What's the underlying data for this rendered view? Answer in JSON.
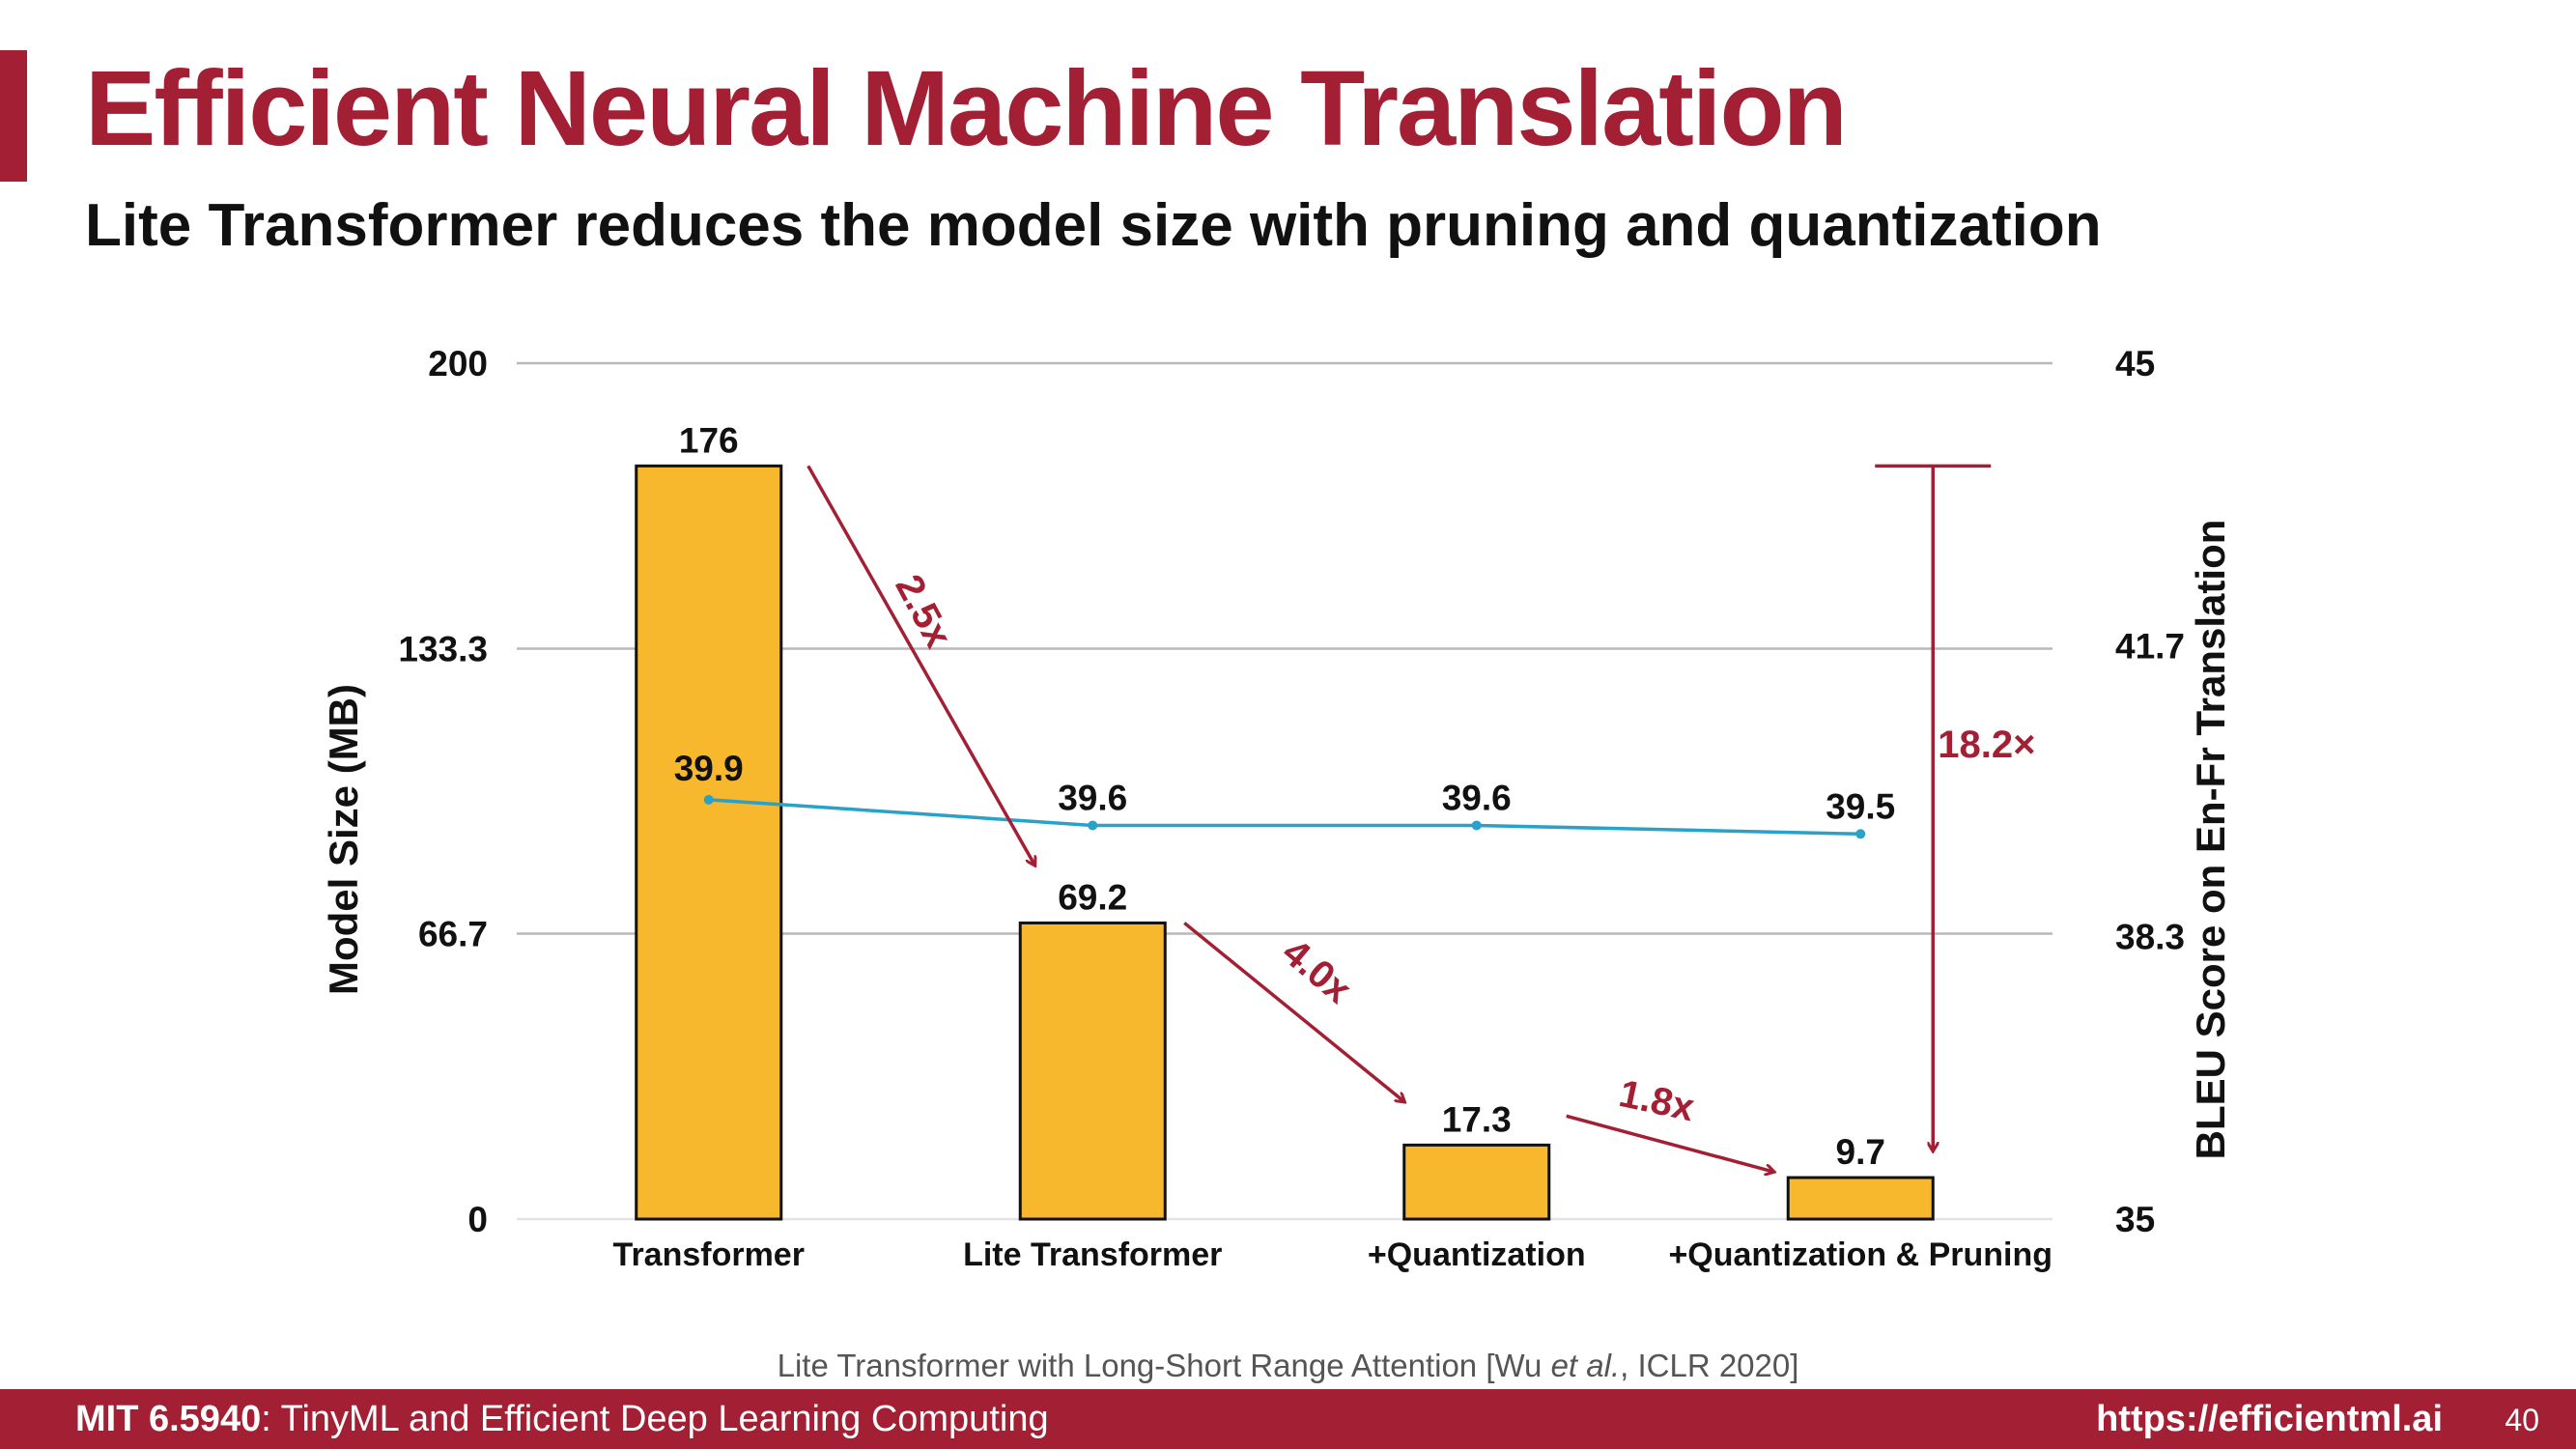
{
  "slide": {
    "title": "Efficient Neural Machine Translation",
    "subtitle": "Lite Transformer reduces the model size with pruning and quantization",
    "citation_prefix": "Lite Transformer with Long-Short Range Attention [Wu ",
    "citation_italic": "et al.",
    "citation_suffix": ", ICLR 2020]",
    "footer_course": "MIT 6.5940",
    "footer_course_title": ": TinyML and Efficient Deep Learning Computing",
    "footer_url": "https://efficientml.ai",
    "page_number": "40"
  },
  "colors": {
    "accent": "#a31f34",
    "bar_fill": "#f7b82e",
    "line": "#2aa1c9"
  },
  "chart_data": {
    "type": "bar",
    "categories": [
      "Transformer",
      "Lite Transformer",
      "+Quantization",
      "+Quantization & Pruning"
    ],
    "series": [
      {
        "values": [
          176,
          69.2,
          17.3,
          9.7
        ],
        "axis": "left",
        "type": "bar"
      },
      {
        "values": [
          39.9,
          39.6,
          39.6,
          39.5
        ],
        "axis": "right",
        "type": "line"
      }
    ],
    "bar_labels": [
      "176",
      "69.2",
      "17.3",
      "9.7"
    ],
    "line_labels": [
      "39.9",
      "39.6",
      "39.6",
      "39.5"
    ],
    "ylabel": "Model Size (MB)",
    "y2label": "BLEU Score on En-Fr Translation",
    "ylim": [
      0,
      200
    ],
    "y2lim": [
      35,
      45
    ],
    "yticks": [
      "0",
      "66.7",
      "133.3",
      "200"
    ],
    "y2ticks": [
      "35",
      "38.3",
      "41.7",
      "45"
    ],
    "grid": true,
    "annotations": [
      {
        "text": "2.5x",
        "from": "Transformer",
        "to": "Lite Transformer"
      },
      {
        "text": "4.0x",
        "from": "Lite Transformer",
        "to": "+Quantization"
      },
      {
        "text": "1.8x",
        "from": "+Quantization",
        "to": "+Quantization & Pruning"
      },
      {
        "text": "18.2×",
        "from": "Transformer",
        "to": "+Quantization & Pruning"
      }
    ]
  }
}
